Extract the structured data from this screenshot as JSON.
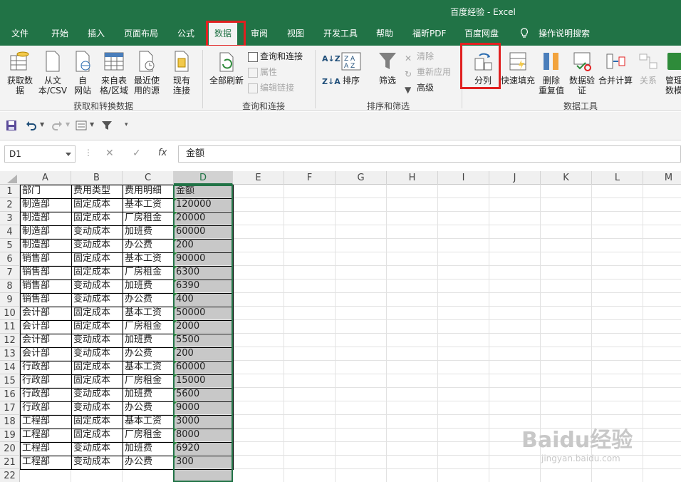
{
  "window": {
    "title": "百度经验  -  Excel"
  },
  "tabs": [
    "文件",
    "开始",
    "插入",
    "页面布局",
    "公式",
    "数据",
    "审阅",
    "视图",
    "开发工具",
    "帮助",
    "福昕PDF",
    "百度网盘",
    "操作说明搜索"
  ],
  "active_tab": "数据",
  "ribbon": {
    "get_transform": {
      "label": "获取和转换数据",
      "get_data": "获取数\n据",
      "from_csv": "从文\n本/CSV",
      "from_web": "自\n网站",
      "from_table": "来自表\n格/区域",
      "recent_sources": "最近使\n用的源",
      "existing": "现有\n连接"
    },
    "queries": {
      "label": "查询和连接",
      "refresh_all": "全部刷新",
      "queries_connections": "查询和连接",
      "properties": "属性",
      "edit_links": "编辑链接"
    },
    "sort_filter": {
      "label": "排序和筛选",
      "sort": "排序",
      "filter": "筛选",
      "clear": "清除",
      "reapply": "重新应用",
      "advanced": "高级"
    },
    "data_tools": {
      "label": "数据工具",
      "text_to_columns": "分列",
      "flash_fill": "快速填充",
      "remove_duplicates": "删除\n重复值",
      "data_validation": "数据验\n证",
      "consolidate": "合并计算",
      "relationships": "关系",
      "manage_model": "管理\n数模"
    }
  },
  "formula_bar": {
    "name_box": "D1",
    "formula": "金额",
    "fx": "fx"
  },
  "columns": [
    "A",
    "B",
    "C",
    "D",
    "E",
    "F",
    "G",
    "H",
    "I",
    "J",
    "K",
    "L",
    "M"
  ],
  "selected_column": "D",
  "rows": [
    [
      "部门",
      "费用类型",
      "费用明细",
      "金额"
    ],
    [
      "制造部",
      "固定成本",
      "基本工资",
      "120000"
    ],
    [
      "制造部",
      "固定成本",
      "厂房租金",
      "20000"
    ],
    [
      "制造部",
      "变动成本",
      "加班费",
      "60000"
    ],
    [
      "制造部",
      "变动成本",
      "办公费",
      "200"
    ],
    [
      "销售部",
      "固定成本",
      "基本工资",
      "90000"
    ],
    [
      "销售部",
      "固定成本",
      "厂房租金",
      "6300"
    ],
    [
      "销售部",
      "变动成本",
      "加班费",
      "6390"
    ],
    [
      "销售部",
      "变动成本",
      "办公费",
      "400"
    ],
    [
      "会计部",
      "固定成本",
      "基本工资",
      "50000"
    ],
    [
      "会计部",
      "固定成本",
      "厂房租金",
      "2000"
    ],
    [
      "会计部",
      "变动成本",
      "加班费",
      "5500"
    ],
    [
      "会计部",
      "变动成本",
      "办公费",
      "200"
    ],
    [
      "行政部",
      "固定成本",
      "基本工资",
      "60000"
    ],
    [
      "行政部",
      "固定成本",
      "厂房租金",
      "15000"
    ],
    [
      "行政部",
      "变动成本",
      "加班费",
      "5600"
    ],
    [
      "行政部",
      "变动成本",
      "办公费",
      "9000"
    ],
    [
      "工程部",
      "固定成本",
      "基本工资",
      "3000"
    ],
    [
      "工程部",
      "固定成本",
      "厂房租金",
      "8000"
    ],
    [
      "工程部",
      "变动成本",
      "加班费",
      "6920"
    ],
    [
      "工程部",
      "变动成本",
      "办公费",
      "300"
    ]
  ],
  "row_numbers": [
    "1",
    "2",
    "3",
    "4",
    "5",
    "6",
    "7",
    "8",
    "9",
    "10",
    "11",
    "12",
    "13",
    "14",
    "15",
    "16",
    "17",
    "18",
    "19",
    "20",
    "21",
    "22"
  ],
  "watermark": {
    "brand": "Baidu经验",
    "url": "jingyan.baidu.com"
  },
  "colors": {
    "excel_green": "#217346",
    "highlight_red": "#e02020",
    "selected_fill": "#c8c8c8"
  }
}
